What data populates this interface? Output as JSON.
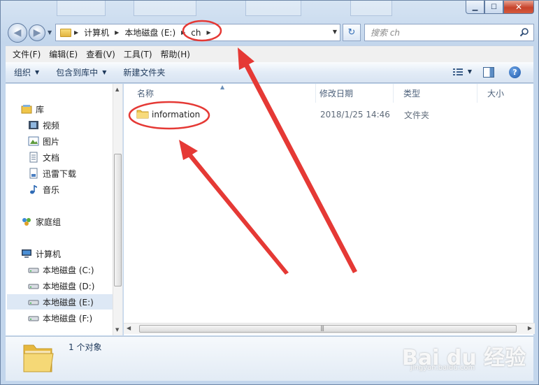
{
  "window": {
    "minimize_glyph": "▁",
    "maximize_glyph": "☐",
    "close_glyph": "✕"
  },
  "nav": {
    "back_glyph": "◀",
    "forward_glyph": "▶",
    "refresh_glyph": "↻",
    "breadcrumbs": [
      "计算机",
      "本地磁盘 (E:)",
      "ch"
    ]
  },
  "search": {
    "placeholder": "搜索 ch"
  },
  "menubar": [
    "文件(F)",
    "编辑(E)",
    "查看(V)",
    "工具(T)",
    "帮助(H)"
  ],
  "commands": {
    "organize": "组织",
    "include_in_library": "包含到库中",
    "new_folder": "新建文件夹"
  },
  "help_glyph": "?",
  "navpane": {
    "libraries": "库",
    "videos": "视频",
    "pictures": "图片",
    "documents": "文档",
    "thunder": "迅雷下载",
    "music": "音乐",
    "homegroup": "家庭组",
    "computer": "计算机",
    "drive_c": "本地磁盘 (C:)",
    "drive_d": "本地磁盘 (D:)",
    "drive_e": "本地磁盘 (E:)",
    "drive_f": "本地磁盘 (F:)"
  },
  "columns": {
    "name": "名称",
    "modified": "修改日期",
    "type": "类型",
    "size": "大小"
  },
  "files": [
    {
      "name": "information",
      "modified": "2018/1/25 14:46",
      "type": "文件夹"
    }
  ],
  "status": {
    "count": "1 个对象"
  },
  "watermark": {
    "brand": "Bai du 经验",
    "sub": "jingyan.baidu.com"
  },
  "colors": {
    "annotation": "#e53935",
    "selection": "#dde8f5",
    "folder": "#f0c64a"
  }
}
